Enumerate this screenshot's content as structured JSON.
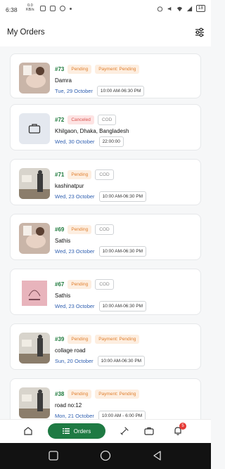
{
  "status_bar": {
    "time": "6:38",
    "net_speed": "0.0",
    "net_unit": "KB/s",
    "battery": "18"
  },
  "header": {
    "title": "My Orders"
  },
  "orders": [
    {
      "id": "#73",
      "status": "Pending",
      "payment": "Payment: Pending",
      "cod": "",
      "address": "Damra",
      "date": "Tue, 29 October",
      "time": "10:00 AM-06:30 PM",
      "thumb": "face-photo"
    },
    {
      "id": "#72",
      "status": "Canceled",
      "payment": "",
      "cod": "COD",
      "address": "Khilgaon, Dhaka, Bangladesh",
      "date": "Wed, 30 October",
      "time": "22:00:00",
      "thumb": "briefcase-icon"
    },
    {
      "id": "#71",
      "status": "Pending",
      "payment": "",
      "cod": "COD",
      "address": "kashinatpur",
      "date": "Wed, 23 October",
      "time": "10:00 AM-06:30 PM",
      "thumb": "room-photo"
    },
    {
      "id": "#69",
      "status": "Pending",
      "payment": "",
      "cod": "COD",
      "address": "Sathis",
      "date": "Wed, 23 October",
      "time": "10:00 AM-06:30 PM",
      "thumb": "face-photo"
    },
    {
      "id": "#67",
      "status": "Pending",
      "payment": "",
      "cod": "COD",
      "address": "Sathis",
      "date": "Wed, 23 October",
      "time": "10:00 AM-06:30 PM",
      "thumb": "logo-pink"
    },
    {
      "id": "#39",
      "status": "Pending",
      "payment": "Payment: Pending",
      "cod": "",
      "address": "collage road",
      "date": "Sun, 20 October",
      "time": "10:00 AM-06:30 PM",
      "thumb": "room-photo"
    },
    {
      "id": "#38",
      "status": "Pending",
      "payment": "Payment: Pending",
      "cod": "",
      "address": "road no:12",
      "date": "Mon, 21 October",
      "time": "10:00 AM - 6:00 PM",
      "thumb": "room-photo"
    }
  ],
  "bottom_nav": {
    "active_label": "Orders",
    "notification_count": "5",
    "items": [
      "home-icon",
      "orders-icon",
      "tools-icon",
      "briefcase-icon",
      "bell-icon"
    ]
  },
  "colors": {
    "accent_green": "#1e7a43",
    "pending_bg": "#fdeee0",
    "pending_text": "#e07f2e",
    "canceled_bg": "#fde3e3",
    "canceled_text": "#d9534f",
    "date_blue": "#2f5fb0"
  }
}
